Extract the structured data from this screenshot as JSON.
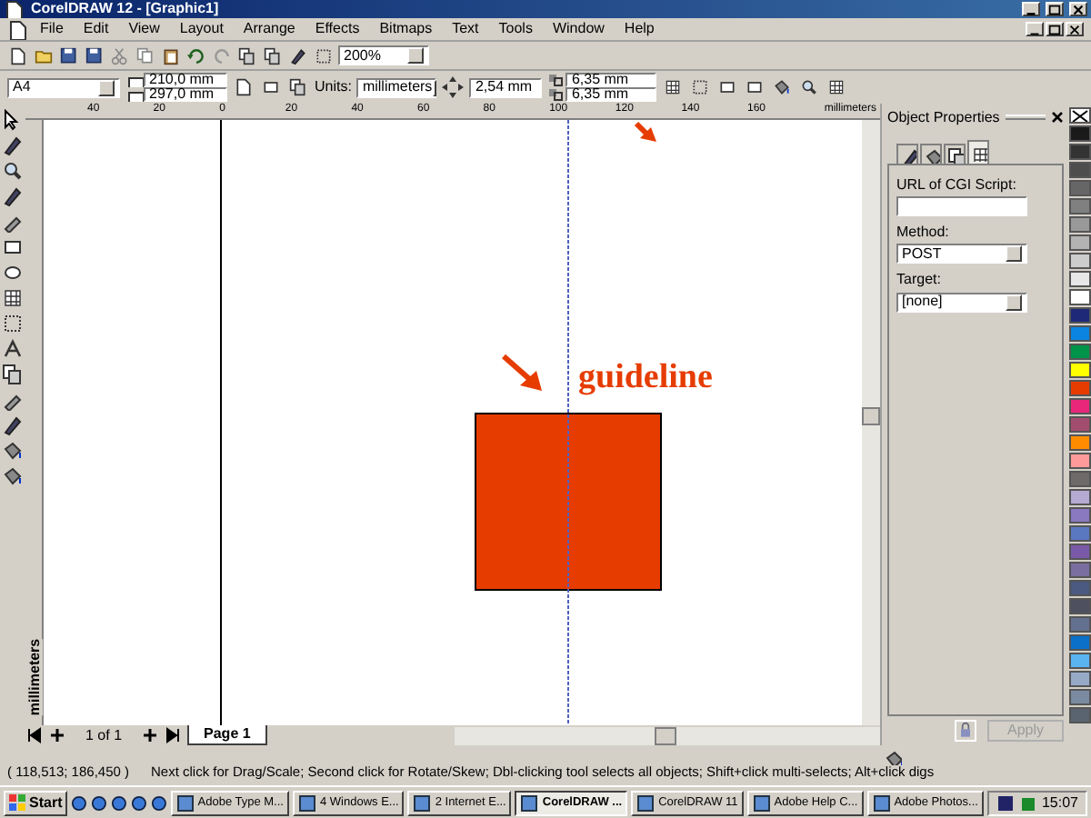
{
  "window": {
    "title": "CorelDRAW 12 - [Graphic1]"
  },
  "menu": [
    "File",
    "Edit",
    "View",
    "Layout",
    "Arrange",
    "Effects",
    "Bitmaps",
    "Text",
    "Tools",
    "Window",
    "Help"
  ],
  "standard_toolbar": {
    "zoom": "200%"
  },
  "property_bar": {
    "paper": "A4",
    "width": "210,0 mm",
    "height": "297,0 mm",
    "units_label": "Units:",
    "units": "millimeters",
    "nudge": "2,54 mm",
    "duplicate_x": "6,35 mm",
    "duplicate_y": "6,35 mm"
  },
  "horizontal_ruler": {
    "labels": [
      "40",
      "20",
      "0",
      "20",
      "40",
      "60",
      "80",
      "100",
      "120",
      "140",
      "160"
    ],
    "unit": "millimeters"
  },
  "vertical_ruler": {
    "unit": "millimeters"
  },
  "canvas": {
    "annotation": "guideline"
  },
  "docker": {
    "title": "Object Properties",
    "tabs": [
      {
        "selected": false
      },
      {
        "selected": false
      },
      {
        "selected": false
      },
      {
        "selected": true
      }
    ],
    "fields": [
      {
        "kind": "text",
        "label": "URL of CGI Script:"
      },
      {
        "kind": "select",
        "label": "Method:",
        "value": "POST"
      },
      {
        "kind": "select",
        "label": "Target:",
        "value": "[none]"
      }
    ],
    "apply": {
      "label": "Apply",
      "disabled": true
    }
  },
  "page_nav": {
    "count": "1 of 1",
    "tabs": [
      {
        "label": "Page 1",
        "selected": true
      }
    ]
  },
  "status_bar": {
    "coordinates": "( 118,513; 186,450 )",
    "hint": "Next click for Drag/Scale; Second click for Rotate/Skew; Dbl-clicking tool selects all objects; Shift+click multi-selects; Alt+click digs"
  },
  "palette": [
    {
      "color": "#1a1a1a"
    },
    {
      "color": "#333333"
    },
    {
      "color": "#4d4d4d"
    },
    {
      "color": "#666666"
    },
    {
      "color": "#808080"
    },
    {
      "color": "#999999"
    },
    {
      "color": "#b3b3b3"
    },
    {
      "color": "#cccccc"
    },
    {
      "color": "#e6e6e6"
    },
    {
      "color": "#ffffff"
    },
    {
      "color": "#1e2a78"
    },
    {
      "color": "#0a84e0"
    },
    {
      "color": "#00944a"
    },
    {
      "color": "#ffff00"
    },
    {
      "color": "#e63c00"
    },
    {
      "color": "#e8277a"
    },
    {
      "color": "#a34d6e"
    },
    {
      "color": "#ff8c00"
    },
    {
      "color": "#ff9a9a"
    },
    {
      "color": "#6e6a6a"
    },
    {
      "color": "#b4aad2"
    },
    {
      "color": "#8a78c0"
    },
    {
      "color": "#5a78c0"
    },
    {
      "color": "#7a5aa8"
    },
    {
      "color": "#7a6ea0"
    },
    {
      "color": "#4a5a80"
    },
    {
      "color": "#4e5060"
    },
    {
      "color": "#647090"
    },
    {
      "color": "#0a70c8"
    },
    {
      "color": "#5ab4f0"
    },
    {
      "color": "#96aac8"
    },
    {
      "color": "#7a8aa0"
    },
    {
      "color": "#5a6470"
    }
  ],
  "taskbar": {
    "start": "Start",
    "tasks": [
      {
        "label": "Adobe Type M...",
        "selected": false
      },
      {
        "label": "4 Windows E...",
        "selected": false
      },
      {
        "label": "2 Internet E...",
        "selected": false
      },
      {
        "label": "CorelDRAW ...",
        "selected": true
      },
      {
        "label": "CorelDRAW 11",
        "selected": false
      },
      {
        "label": "Adobe Help C...",
        "selected": false
      },
      {
        "label": "Adobe Photos...",
        "selected": false
      }
    ],
    "clock": "15:07"
  }
}
